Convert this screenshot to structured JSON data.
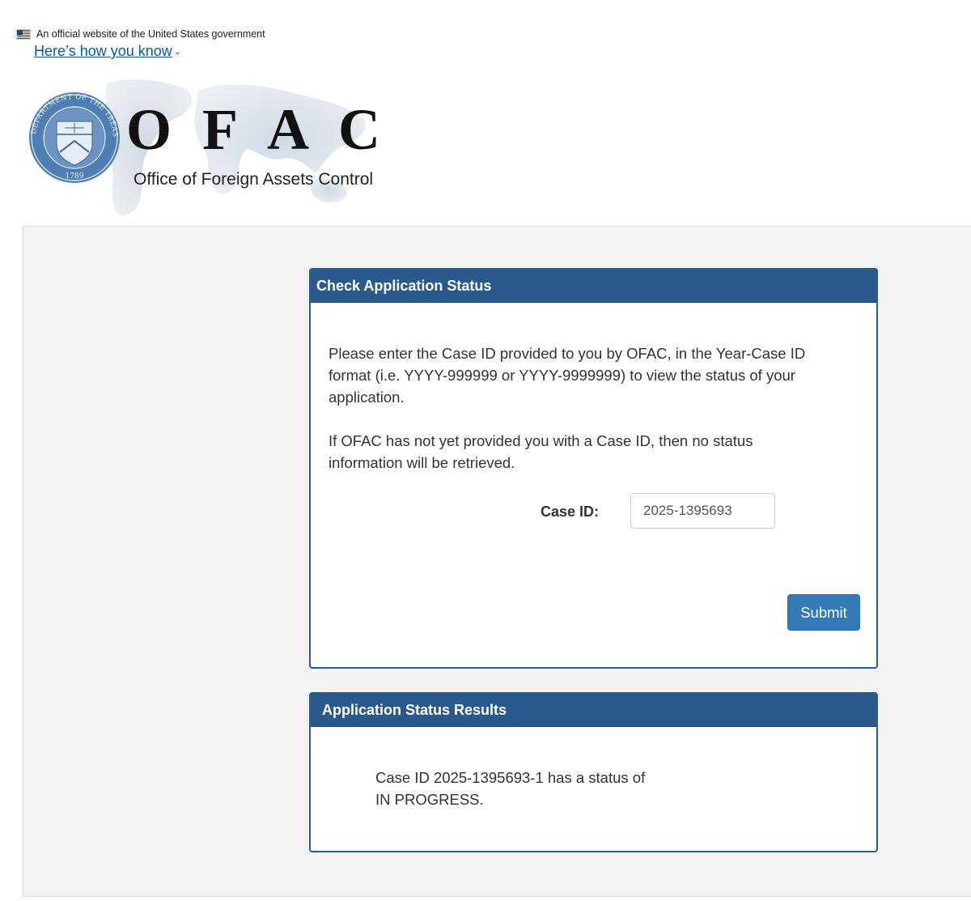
{
  "gov_banner": {
    "official_text": "An official website of the United States government",
    "how_know_label": "Here’s how you know",
    "chevron": "⌄"
  },
  "logo": {
    "letters": [
      "O",
      "F",
      "A",
      "C"
    ],
    "subtitle": "Office of Foreign Assets Control",
    "seal_text": "THE DEPARTMENT OF THE TREASURY",
    "seal_year": "1789"
  },
  "check_status": {
    "heading": "Check Application Status",
    "instruction_1": "Please enter the Case ID provided to you by OFAC, in the Year-Case ID format (i.e. YYYY-999999 or YYYY-9999999) to view the status of your application.",
    "instruction_2": "If OFAC has not yet provided you with a Case ID, then no status information will be retrieved.",
    "case_id_label": "Case ID:",
    "case_id_value": "2025-1395693",
    "submit_label": "Submit"
  },
  "results": {
    "heading": "Application Status Results",
    "line_1": "Case ID 2025-1395693-1 has a status of",
    "line_2": "IN PROGRESS."
  },
  "colors": {
    "panel_header": "#2a5a8c",
    "link": "#005ea2",
    "button": "#337ab7",
    "seal": "#4f7fb2"
  }
}
